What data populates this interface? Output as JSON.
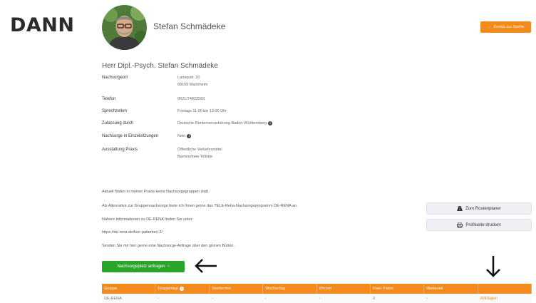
{
  "brand": "DANN",
  "profile": {
    "name": "Stefan Schmädeke",
    "full_title": "Herr Dipl.-Psych. Stefan Schmädeke",
    "back_button": "Zurück zur Suche"
  },
  "details": {
    "location_label": "Nachsorgeort",
    "location_street": "Lameystr. 20",
    "location_city": "68165 Mannheim",
    "phone_label": "Telefon",
    "phone_value": "0621/74822093",
    "hours_label": "Sprechzeiten",
    "hours_value": "Freitags 11:00 bis 13:00 Uhr",
    "approval_label": "Zulassung durch",
    "approval_value": "Deutsche Rentenversicherung Baden-Württemberg",
    "individual_label": "Nachsorge in Einzelsitzungen",
    "individual_value": "Nein",
    "equipment_label": "Ausstattung Praxis",
    "equipment_1": "Öffentliche Verkehrsmittel",
    "equipment_2": "Barrierefreie Toilette"
  },
  "paragraphs": {
    "p1": "Aktuell finden in meiner Praxis keine Nachsorgegruppen statt.",
    "p2": "Als Alternative zur Gruppennachsorge biete ich Ihnen gerne das TELE-Reha-Nachsorgeprogramm DE-RENA an.",
    "p3": "Nähere Informationen zu DE-RENA finden Sie unter:",
    "p4": "https://de-rena.de/fuer-patienten-2/",
    "p5": "Senden Sie mir hier gerne eine Nachsorge-Anfrage über den grünen Button."
  },
  "buttons": {
    "route": "Zum Routenplaner",
    "print": "Profilseite drucken",
    "request": "Nachsorgeplatz anfragen"
  },
  "table": {
    "headers": [
      "Gruppe",
      "Gruppentyp",
      "Starttermin",
      "Wochentag",
      "Uhrzeit",
      "Freie Plätze",
      "Wartezeit",
      ""
    ],
    "row": [
      "DE-RENA",
      "-",
      "-",
      "-",
      "-",
      "3",
      "-",
      "Anfragen"
    ]
  },
  "colors": {
    "accent": "#f28a1e",
    "cta": "#2aa52a"
  }
}
